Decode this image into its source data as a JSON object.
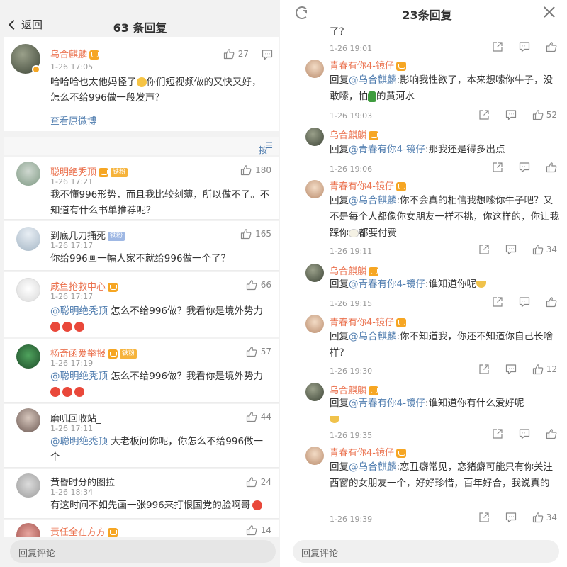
{
  "left": {
    "back_label": "返回",
    "title": "63 条回复",
    "main": {
      "user": "乌合麒麟",
      "time": "1-26 17:05",
      "likes": "27",
      "text_a": "哈哈哈也太他妈怪了",
      "text_b": "你们短视频做的又快又好，怎么不给996做一段发声？",
      "view_original": "查看原微博"
    },
    "sort_label": "按热度",
    "replies": [
      {
        "user": "聪明绝秃顶",
        "tag": "铁粉",
        "time": "1-26 17:21",
        "likes": "180",
        "text": "我不懂996形势，而且我比较刻薄，所以做不了。不知道有什么书单推荐呢？"
      },
      {
        "user": "到底几刀捅死",
        "tag": "铁粉",
        "time": "1-26 17:17",
        "likes": "165",
        "text": "你给996画一幅人家不就给996做一个了？"
      },
      {
        "user": "咸鱼抢救中心",
        "time": "1-26 17:17",
        "likes": "66",
        "mention": "@聪明绝秃顶",
        "text": " 怎么不给996做？我看你是境外势力"
      },
      {
        "user": "杨奇函爱举报",
        "tag": "铁粉",
        "time": "1-26 17:19",
        "likes": "57",
        "mention": "@聪明绝秃顶",
        "text": " 怎么不给996做？我看你是境外势力"
      },
      {
        "user": "磨叽回收站_",
        "time": "1-26 17:11",
        "likes": "44",
        "mention": "@聪明绝秃顶",
        "text": " 大老板问你呢，你怎么不给996做一个"
      },
      {
        "user": "黄昏时分的图拉",
        "time": "1-26 18:34",
        "likes": "24",
        "text": "有这时间不如先画一张996来打恨国党的脸啊哥"
      },
      {
        "user": "责任全在方方",
        "likes": "14"
      }
    ],
    "reply_placeholder": "回复评论"
  },
  "right": {
    "title": "23条回复",
    "top_fragment": "了？",
    "top_time": "1-26 19:01",
    "rows": [
      {
        "user": "青春有你4-镜仔",
        "prefix": "回复",
        "mention": "@乌合麒麟",
        "text": ":影响我性欲了，本来想嗦你牛子，没敢嗦，怕",
        "text2": "的黄河水",
        "time": "1-26 19:03",
        "likes": "52"
      },
      {
        "user": "乌合麒麟",
        "prefix": "回复",
        "mention": "@青春有你4-镜仔",
        "text": ":那我还是得多出点",
        "time": "1-26 19:06",
        "likes": ""
      },
      {
        "user": "青春有你4-镜仔",
        "prefix": "回复",
        "mention": "@乌合麒麟",
        "text": ":你不会真的相信我想嗦你牛子吧？又不是每个人都像你女朋友一样不挑，你这样的，你让我踩你",
        "text2": "都要付费",
        "time": "1-26 19:11",
        "likes": "34"
      },
      {
        "user": "乌合麒麟",
        "prefix": "回复",
        "mention": "@青春有你4-镜仔",
        "text": ":谁知道你呢",
        "time": "1-26 19:15",
        "likes": ""
      },
      {
        "user": "青春有你4-镜仔",
        "prefix": "回复",
        "mention": "@乌合麒麟",
        "text": ":你不知道我，你还不知道你自己长啥样？",
        "time": "1-26 19:30",
        "likes": "12"
      },
      {
        "user": "乌合麒麟",
        "prefix": "回复",
        "mention": "@青春有你4-镜仔",
        "text": ":谁知道你有什么爱好呢",
        "time": "1-26 19:35",
        "likes": ""
      },
      {
        "user": "青春有你4-镜仔",
        "prefix": "回复",
        "mention": "@乌合麒麟",
        "text": ":恋丑癖常见，恋猪癖可能只有你关注西窗的女朋友一个，好好珍惜，百年好合，我说真的",
        "time": "1-26 19:39",
        "likes": "34"
      }
    ],
    "reply_placeholder": "回复评论"
  }
}
